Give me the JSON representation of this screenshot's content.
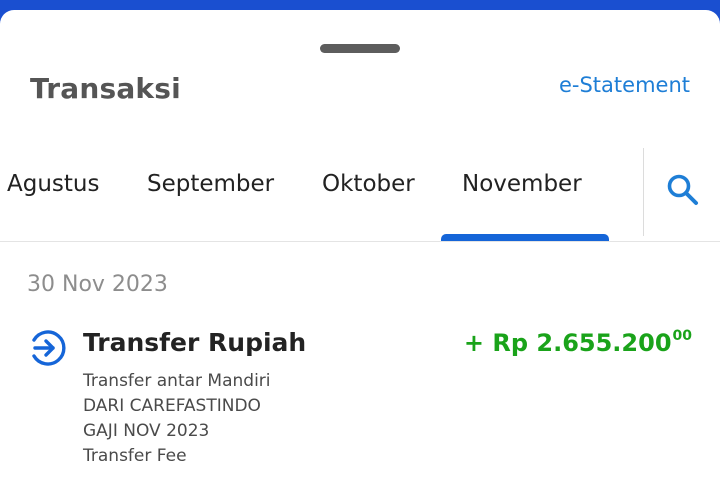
{
  "header": {
    "title": "Transaksi",
    "estatement_label": "e-Statement"
  },
  "tabs": [
    {
      "label": "Agustus",
      "active": false
    },
    {
      "label": "September",
      "active": false
    },
    {
      "label": "Oktober",
      "active": false
    },
    {
      "label": "November",
      "active": true
    }
  ],
  "search": {
    "icon": "search-icon"
  },
  "colors": {
    "accent": "#1565d8",
    "link": "#1e7ed6",
    "credit": "#1aa31a",
    "background_top": "#1a4fd0"
  },
  "transactions": [
    {
      "date": "30 Nov 2023",
      "icon": "transfer-in-icon",
      "title": "Transfer Rupiah",
      "amount_main": "+ Rp 2.655.200",
      "amount_decimal": "00",
      "details": [
        "Transfer antar Mandiri",
        "DARI CAREFASTINDO",
        "GAJI NOV 2023",
        "Transfer Fee"
      ]
    }
  ]
}
